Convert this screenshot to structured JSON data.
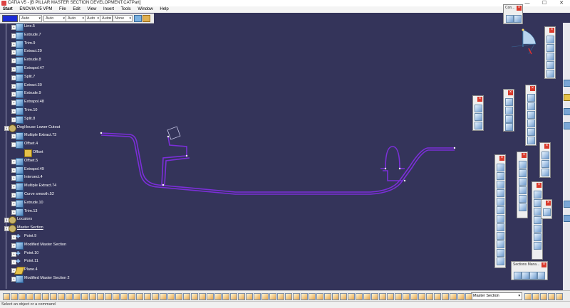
{
  "window": {
    "title": "CATIA V5 - [B PILLAR MASTER SECTION DEVELOPMENT.CATPart]",
    "minimize": "—",
    "maximize": "☐",
    "close": "✕"
  },
  "menu": [
    "Start",
    "ENOVIA V5 VPM",
    "File",
    "Edit",
    "View",
    "Insert",
    "Tools",
    "Window",
    "Help"
  ],
  "toolbar": {
    "color_label": "",
    "line_type": "Auto",
    "thickness": "Auto",
    "weight": "Auto",
    "layer1": "Auto",
    "layer2": "Auto",
    "none_label": "None"
  },
  "tree": [
    {
      "label": "Line.5",
      "icon": "surface",
      "indent": 1,
      "exp": "+"
    },
    {
      "label": "Extrude.7",
      "icon": "surface",
      "indent": 1,
      "exp": "+"
    },
    {
      "label": "Trim.9",
      "icon": "surface",
      "indent": 1,
      "exp": "+"
    },
    {
      "label": "Extract.29",
      "icon": "surface",
      "indent": 1,
      "exp": "+"
    },
    {
      "label": "Extrude.8",
      "icon": "surface",
      "indent": 1,
      "exp": "+"
    },
    {
      "label": "Extrapol.47",
      "icon": "surface",
      "indent": 1,
      "exp": "+"
    },
    {
      "label": "Split.7",
      "icon": "surface",
      "indent": 1,
      "exp": "+"
    },
    {
      "label": "Extract.30",
      "icon": "surface",
      "indent": 1,
      "exp": "+"
    },
    {
      "label": "Extrude.9",
      "icon": "surface",
      "indent": 1,
      "exp": "+"
    },
    {
      "label": "Extrapol.48",
      "icon": "surface",
      "indent": 1,
      "exp": "+"
    },
    {
      "label": "Trim.10",
      "icon": "surface",
      "indent": 1,
      "exp": "+"
    },
    {
      "label": "Split.8",
      "icon": "surface",
      "indent": 1,
      "exp": "+"
    },
    {
      "label": "DogHouse Lower Cutout",
      "icon": "gear",
      "indent": 0,
      "exp": "-"
    },
    {
      "label": "Multiple Extract.73",
      "icon": "surface",
      "indent": 1,
      "exp": "+"
    },
    {
      "label": "Offset.4",
      "icon": "surface",
      "indent": 1,
      "exp": "-"
    },
    {
      "label": "Offset",
      "icon": "folder",
      "indent": 2,
      "exp": ""
    },
    {
      "label": "Offset.5",
      "icon": "surface",
      "indent": 1,
      "exp": "+"
    },
    {
      "label": "Extrapol.49",
      "icon": "surface",
      "indent": 1,
      "exp": "+"
    },
    {
      "label": "Intersect.4",
      "icon": "surface",
      "indent": 1,
      "exp": "+"
    },
    {
      "label": "Multiple Extract.74",
      "icon": "surface",
      "indent": 1,
      "exp": "+"
    },
    {
      "label": "Curve smooth.52",
      "icon": "surface",
      "indent": 1,
      "exp": "+"
    },
    {
      "label": "Extrude.10",
      "icon": "surface",
      "indent": 1,
      "exp": "+"
    },
    {
      "label": "Trim.13",
      "icon": "surface",
      "indent": 1,
      "exp": "+"
    },
    {
      "label": "Locators",
      "icon": "gear",
      "indent": 0,
      "exp": "+"
    },
    {
      "label": "Master Section",
      "icon": "gear",
      "indent": 0,
      "exp": "-"
    },
    {
      "label": "Point.9",
      "icon": "point",
      "indent": 1,
      "exp": "+"
    },
    {
      "label": "Modified Master Section",
      "icon": "surface",
      "indent": 1,
      "exp": "+"
    },
    {
      "label": "Point.10",
      "icon": "point",
      "indent": 1,
      "exp": "+"
    },
    {
      "label": "Point.11",
      "icon": "point",
      "indent": 1,
      "exp": "+"
    },
    {
      "label": "Plane.4",
      "icon": "plane",
      "indent": 1,
      "exp": "+"
    },
    {
      "label": "Modified Master Section 2",
      "icon": "surface",
      "indent": 1,
      "exp": "+"
    }
  ],
  "con_panel": {
    "title": "Con..."
  },
  "sections_panel": {
    "title": "Sections Mana..."
  },
  "bottom": {
    "section_select": "Master Section"
  },
  "status": {
    "prompt": "Select an object or a command"
  },
  "colors": {
    "background": "#34345a",
    "curve": "#7b2fd8",
    "accent": "#1b2bd6"
  }
}
